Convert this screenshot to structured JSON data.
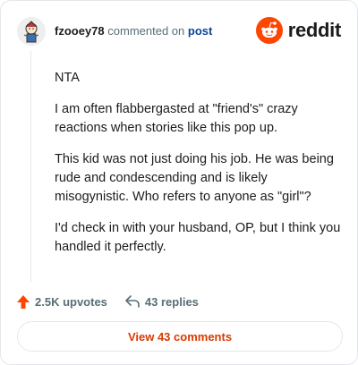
{
  "header": {
    "username": "fzooey78",
    "commented_text": "commented on",
    "post_link": "post",
    "logo_text": "reddit"
  },
  "comment": {
    "paragraphs": [
      "NTA",
      "I am often flabbergasted at \"friend's\" crazy reactions when stories like this pop up.",
      "This kid was not just doing his job. He was being rude and condescending and is likely misogynistic. Who refers to anyone as \"girl\"?",
      "I'd check in with your husband, OP, but I think you handled it perfectly."
    ]
  },
  "actions": {
    "upvotes": "2.5K upvotes",
    "replies": "43 replies"
  },
  "cta": {
    "label": "View 43 comments"
  },
  "colors": {
    "reddit_orange": "#ff4500",
    "link_blue": "#0a449b",
    "upvote": "#ff4500",
    "cta_text": "#d93a00"
  }
}
